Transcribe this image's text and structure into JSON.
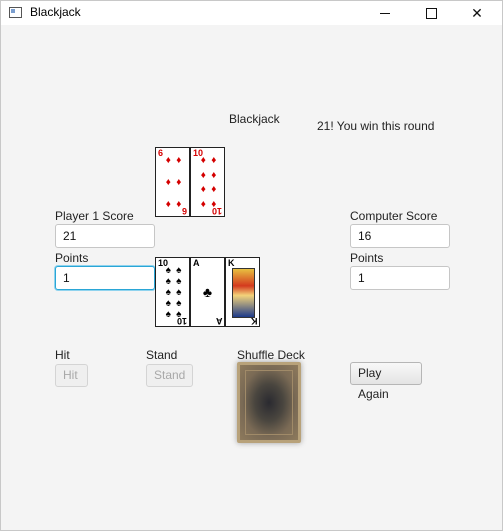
{
  "window": {
    "title": "Blackjack"
  },
  "header": {
    "title": "Blackjack",
    "status": "21! You win this round"
  },
  "player": {
    "score_label": "Player 1 Score",
    "score_value": "21",
    "points_label": "Points",
    "points_value": "1",
    "cards": [
      {
        "rank": "10",
        "suit": "♠",
        "color": "black"
      },
      {
        "rank": "A",
        "suit": "♣",
        "color": "black"
      },
      {
        "rank": "K",
        "suit": "♦",
        "color": "red"
      }
    ]
  },
  "computer": {
    "score_label": "Computer Score",
    "score_value": "16",
    "points_label": "Points",
    "points_value": "1",
    "cards": [
      {
        "rank": "6",
        "suit": "♦",
        "color": "red"
      },
      {
        "rank": "10",
        "suit": "♦",
        "color": "red"
      }
    ]
  },
  "controls": {
    "hit_label": "Hit",
    "hit_button": "Hit",
    "stand_label": "Stand",
    "stand_button": "Stand",
    "shuffle_label": "Shuffle Deck",
    "play_again_button": "Play Again"
  },
  "colors": {
    "focus": "#2aa6d6",
    "card_red": "#d40000"
  }
}
